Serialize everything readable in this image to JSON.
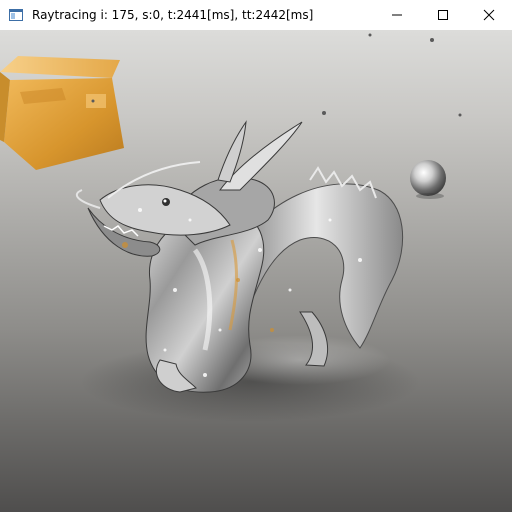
{
  "window": {
    "title": "Raytracing i: 175, s:0, t:2441[ms], tt:2442[ms]",
    "icon": "app-window-icon",
    "controls": [
      "minimize-icon",
      "maximize-icon",
      "close-icon"
    ]
  },
  "scene": {
    "objects": [
      "gold-cube",
      "glass-dragon",
      "chrome-sphere"
    ],
    "colors": {
      "background_top": "#dcdcda",
      "background_bottom": "#4f4e4d",
      "cube": "#e0a23a",
      "dragon": "#bfc0c2",
      "sphere": "#d9d9d9"
    }
  }
}
